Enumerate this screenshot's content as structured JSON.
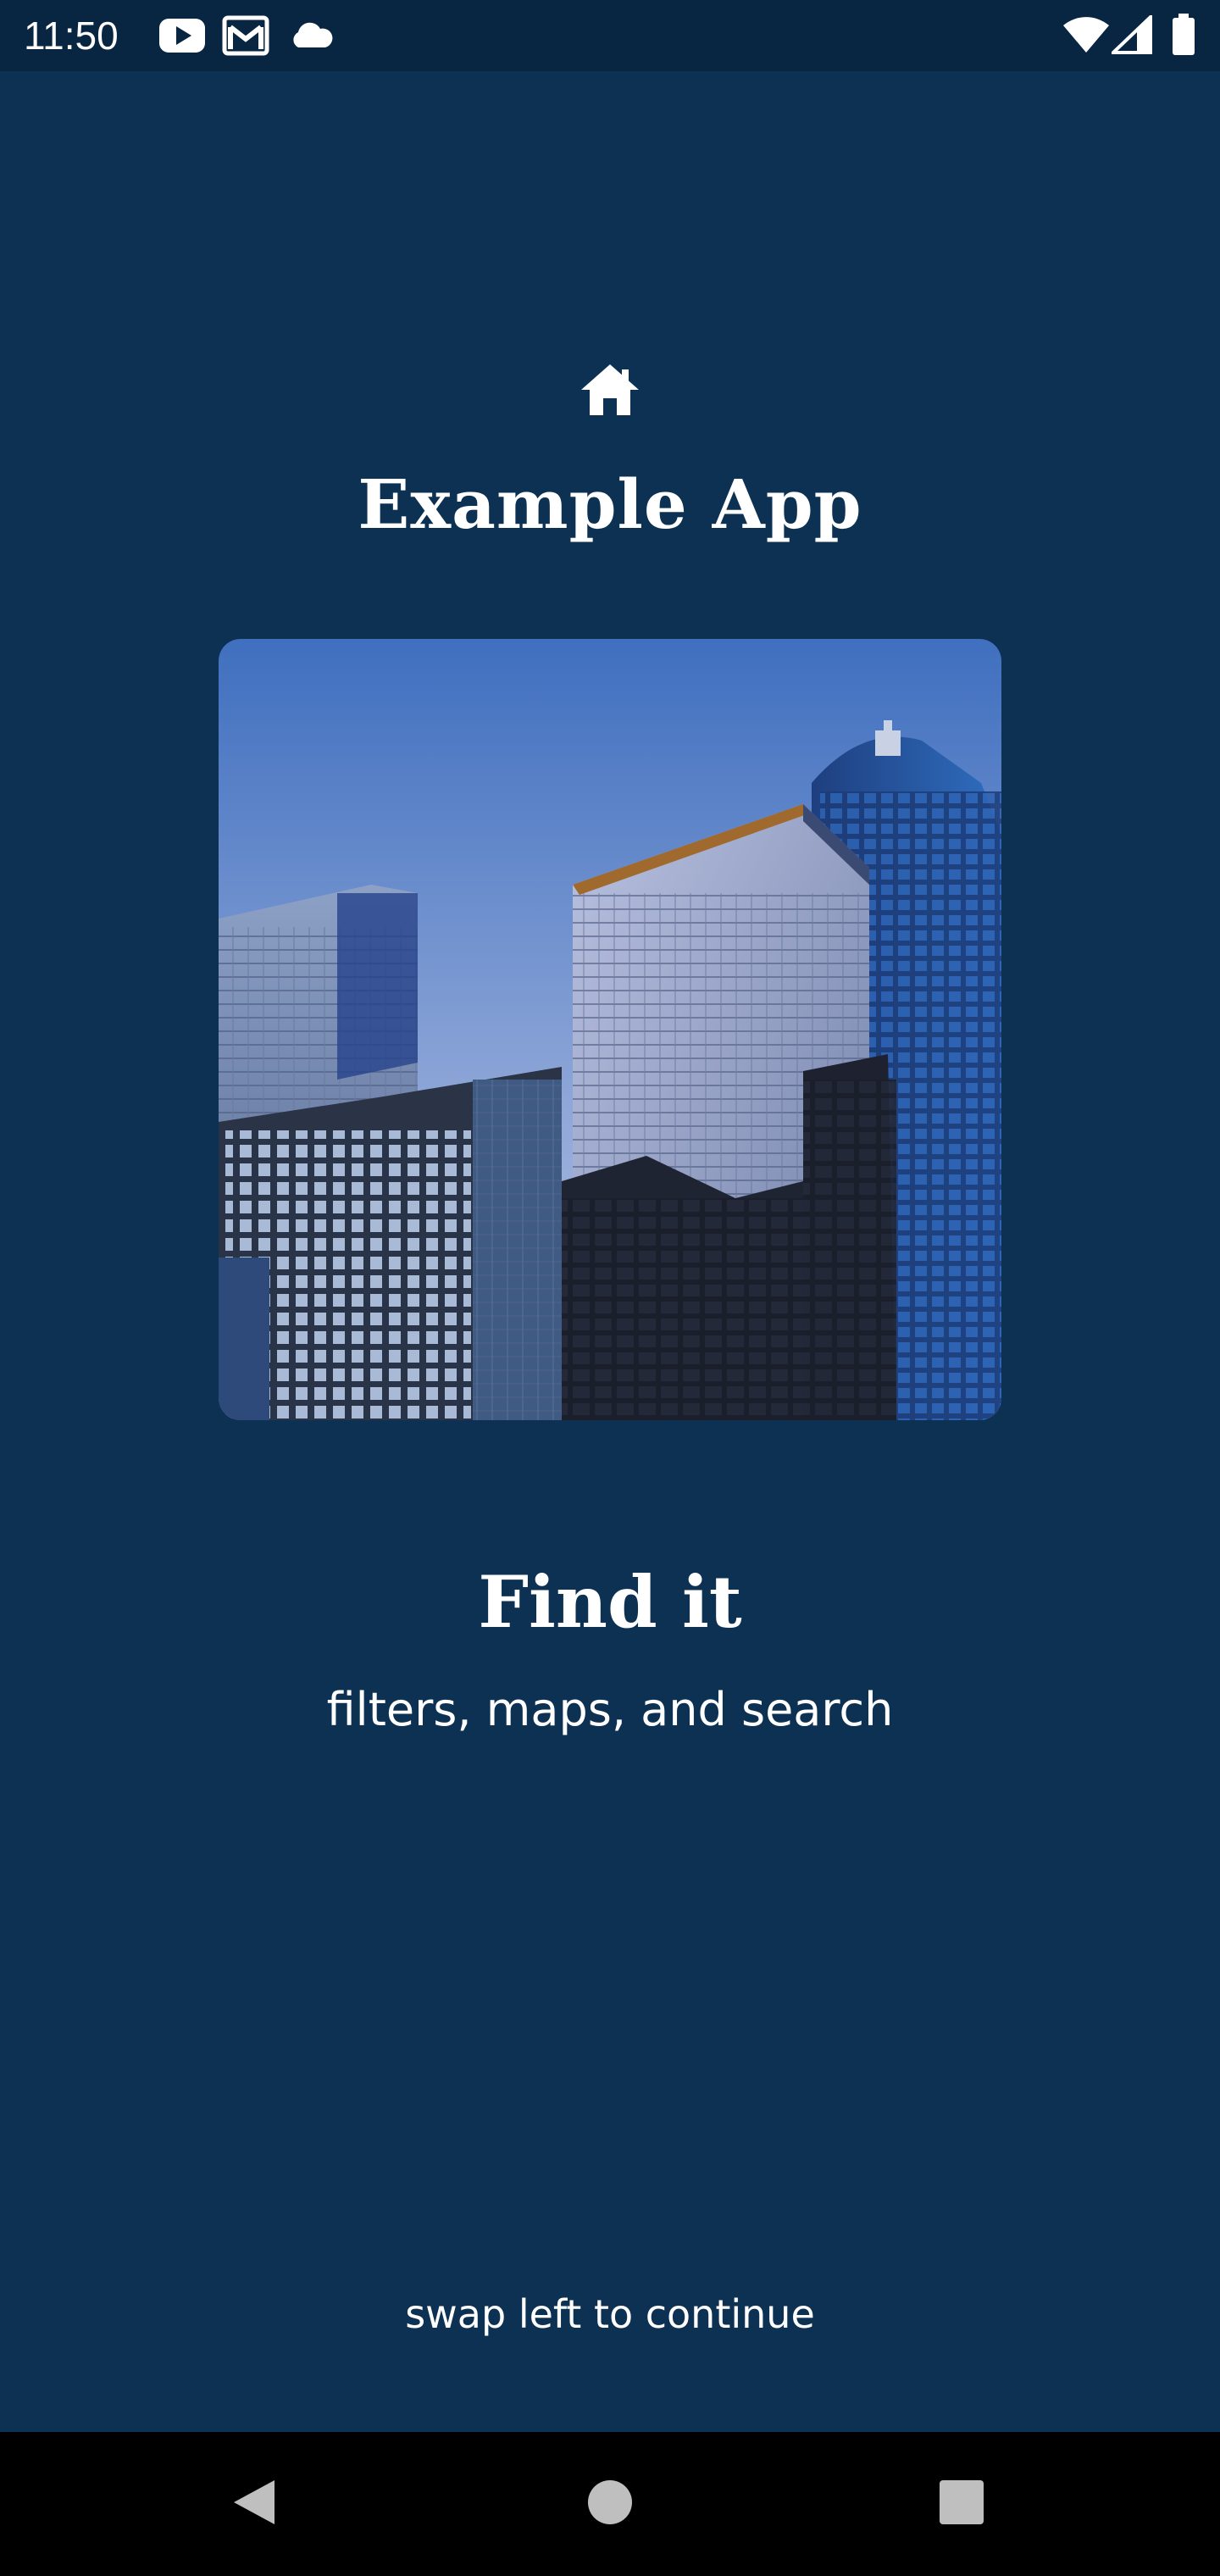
{
  "status_bar": {
    "time": "11:50",
    "left_icons": [
      "youtube-icon",
      "gmail-icon",
      "cloud-icon"
    ],
    "right_icons": [
      "wifi-icon",
      "signal-icon",
      "battery-icon"
    ]
  },
  "header": {
    "icon": "home-icon",
    "app_title": "Example App"
  },
  "slide": {
    "image": "city-buildings-photo",
    "title": "Find it",
    "subtitle": "filters, maps, and search"
  },
  "footer": {
    "hint": "swap left to continue"
  },
  "nav_bar": {
    "buttons": [
      "back-icon",
      "home-circle-icon",
      "recents-icon"
    ]
  },
  "colors": {
    "background": "#0c3152",
    "status_bar": "#082541",
    "nav_bar": "#000000",
    "text": "#ffffff"
  }
}
